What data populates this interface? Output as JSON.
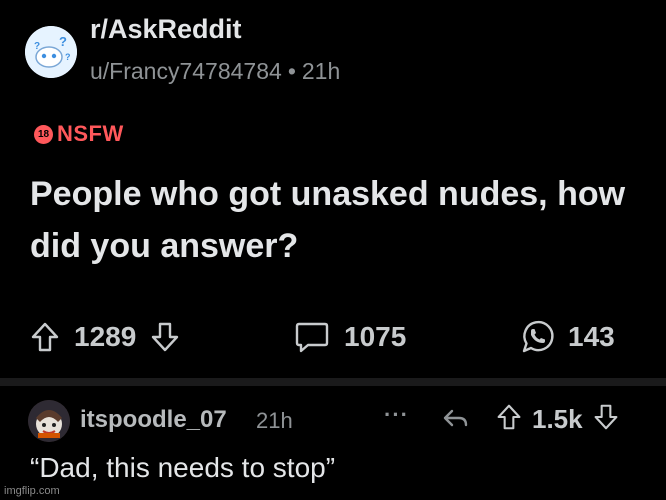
{
  "post": {
    "subreddit": "r/AskReddit",
    "author": "u/Francy74784784",
    "separator": "•",
    "time": "21h",
    "nsfw_badge": "18",
    "nsfw_label": "NSFW",
    "title": "People who got unasked nudes, how did you answer?",
    "upvotes": "1289",
    "comments": "1075",
    "shares": "143"
  },
  "comment": {
    "username": "itspoodle_07",
    "time": "21h",
    "more": "···",
    "score": "1.5k",
    "body": "“Dad, this needs to stop”"
  },
  "watermark": "imgflip.com",
  "colors": {
    "background": "#000000",
    "nsfw": "#ff585b",
    "text": "#e4e6e8",
    "muted": "#8f9396"
  },
  "icons": [
    "subreddit-avatar-icon",
    "upvote-icon",
    "downvote-icon",
    "comment-icon",
    "whatsapp-icon",
    "reply-icon"
  ]
}
